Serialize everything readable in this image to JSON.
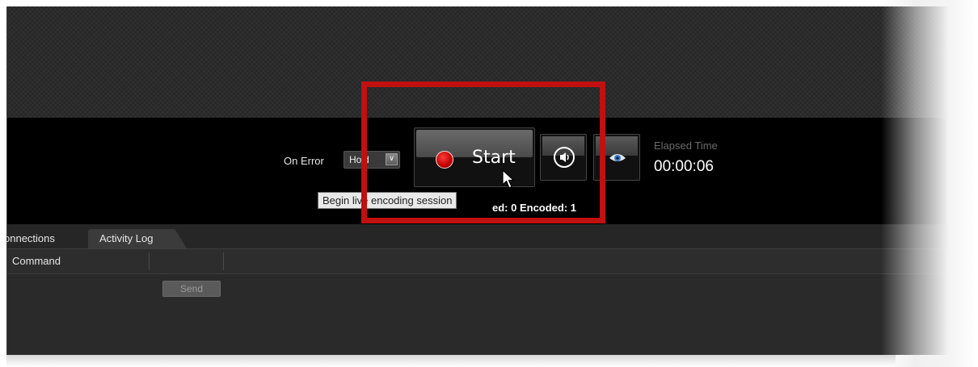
{
  "control_bar": {
    "on_error_label": "On Error",
    "on_error_value": "Hold",
    "start_label": "Start",
    "elapsed_label": "Elapsed Time",
    "elapsed_value": "00:00:06",
    "stats_text": "ed: 0 Encoded: 1"
  },
  "tooltip": {
    "text": "Begin live encoding session"
  },
  "tabs": [
    {
      "label": "onnections"
    },
    {
      "label": "Activity Log"
    }
  ],
  "command_panel": {
    "column_title": "Command",
    "send_label": "Send"
  },
  "colors": {
    "highlight": "#c01010",
    "record_red": "#d00000",
    "bar_background": "#000000"
  },
  "icons": {
    "record": "record-dot-icon",
    "audio": "speaker-icon",
    "preview": "eye-icon",
    "dropdown": "chevron-down-icon",
    "cursor": "mouse-cursor-icon"
  }
}
